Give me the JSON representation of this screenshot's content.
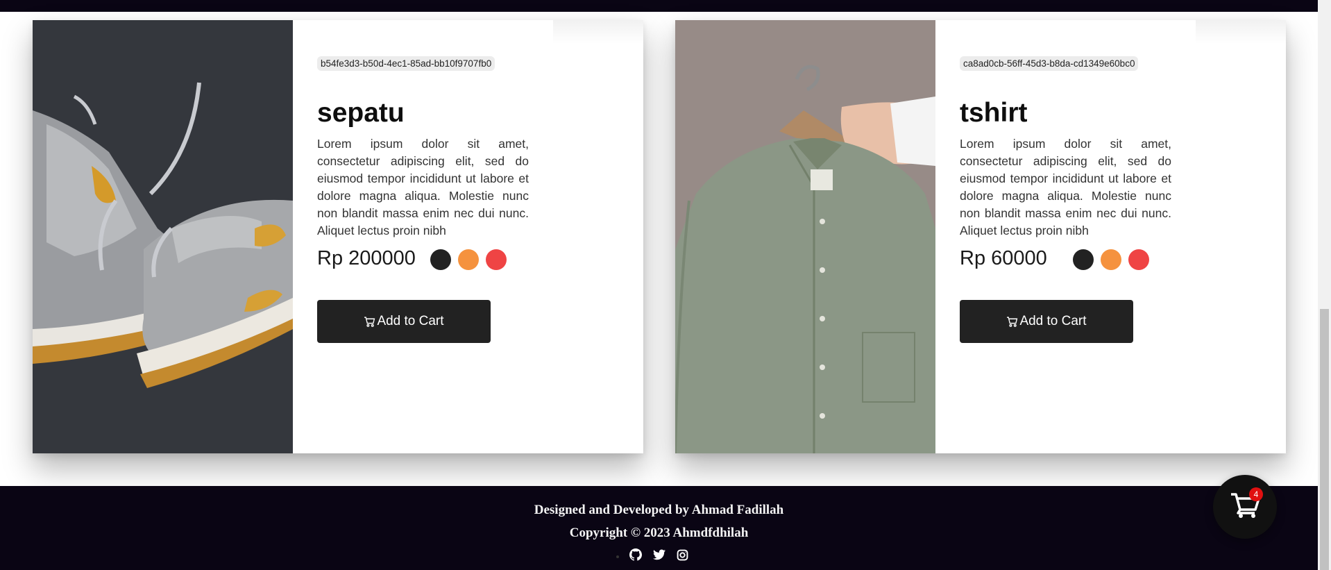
{
  "products": [
    {
      "id": "b54fe3d3-b50d-4ec1-85ad-bb10f9707fb0",
      "name": "sepatu",
      "description": "Lorem ipsum dolor sit amet, consectetur adipiscing elit, sed do eiusmod tempor incididunt ut labore et dolore magna aliqua. Molestie nunc non blandit massa enim nec dui nunc. Aliquet lectus proin nibh",
      "price": "Rp 200000",
      "image": "sneakers-photo",
      "colors": [
        "#222222",
        "#f5923e",
        "#ef4444"
      ],
      "button_label": "Add to Cart"
    },
    {
      "id": "ca8ad0cb-56ff-45d3-b8da-cd1349e60bc0",
      "name": "tshirt",
      "description": "Lorem ipsum dolor sit amet, consectetur adipiscing elit, sed do eiusmod tempor incididunt ut labore et dolore magna aliqua. Molestie nunc non blandit massa enim nec dui nunc. Aliquet lectus proin nibh",
      "price": "Rp 60000",
      "image": "shirt-on-hanger-photo",
      "colors": [
        "#222222",
        "#f5923e",
        "#ef4444"
      ],
      "button_label": "Add to Cart"
    }
  ],
  "footer": {
    "line1": "Designed and Developed by Ahmad Fadillah",
    "line2": "Copyright © 2023 Ahmdfdhilah",
    "social_icons": [
      "github-icon",
      "twitter-icon",
      "instagram-icon"
    ]
  },
  "cart": {
    "count": "4",
    "icon": "shopping-cart-icon"
  },
  "colors": {
    "dark": "#0a0514",
    "button": "#222222",
    "badge": "#e01010"
  }
}
